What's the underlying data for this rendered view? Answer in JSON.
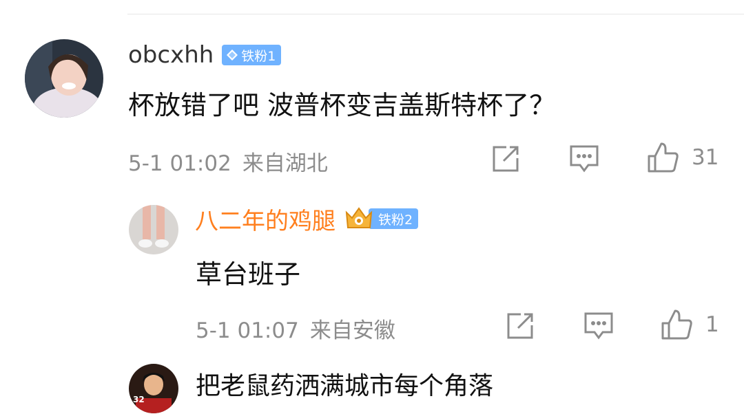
{
  "comment1": {
    "username": "obcxhh",
    "badge": "铁粉1",
    "text": "杯放错了吧 波普杯变吉盖斯特杯了？",
    "time": "5-1 01:02",
    "location": "来自湖北",
    "likes": "31"
  },
  "reply1": {
    "username": "八二年的鸡腿",
    "badge": "铁粉2",
    "text": "草台班子",
    "time": "5-1 01:07",
    "location": "来自安徽",
    "likes": "1"
  },
  "reply2": {
    "text": "把老鼠药洒满城市每个角落",
    "avatar_label": "32"
  },
  "icons": {
    "share": "share-icon",
    "comment": "comment-icon",
    "like": "thumbs-up-icon",
    "badge": "diamond-icon",
    "crown": "crown-icon"
  },
  "colors": {
    "accent_name": "#ff7f1e",
    "badge_bg": "#6fb2ff",
    "meta_text": "#8c8c8c"
  }
}
